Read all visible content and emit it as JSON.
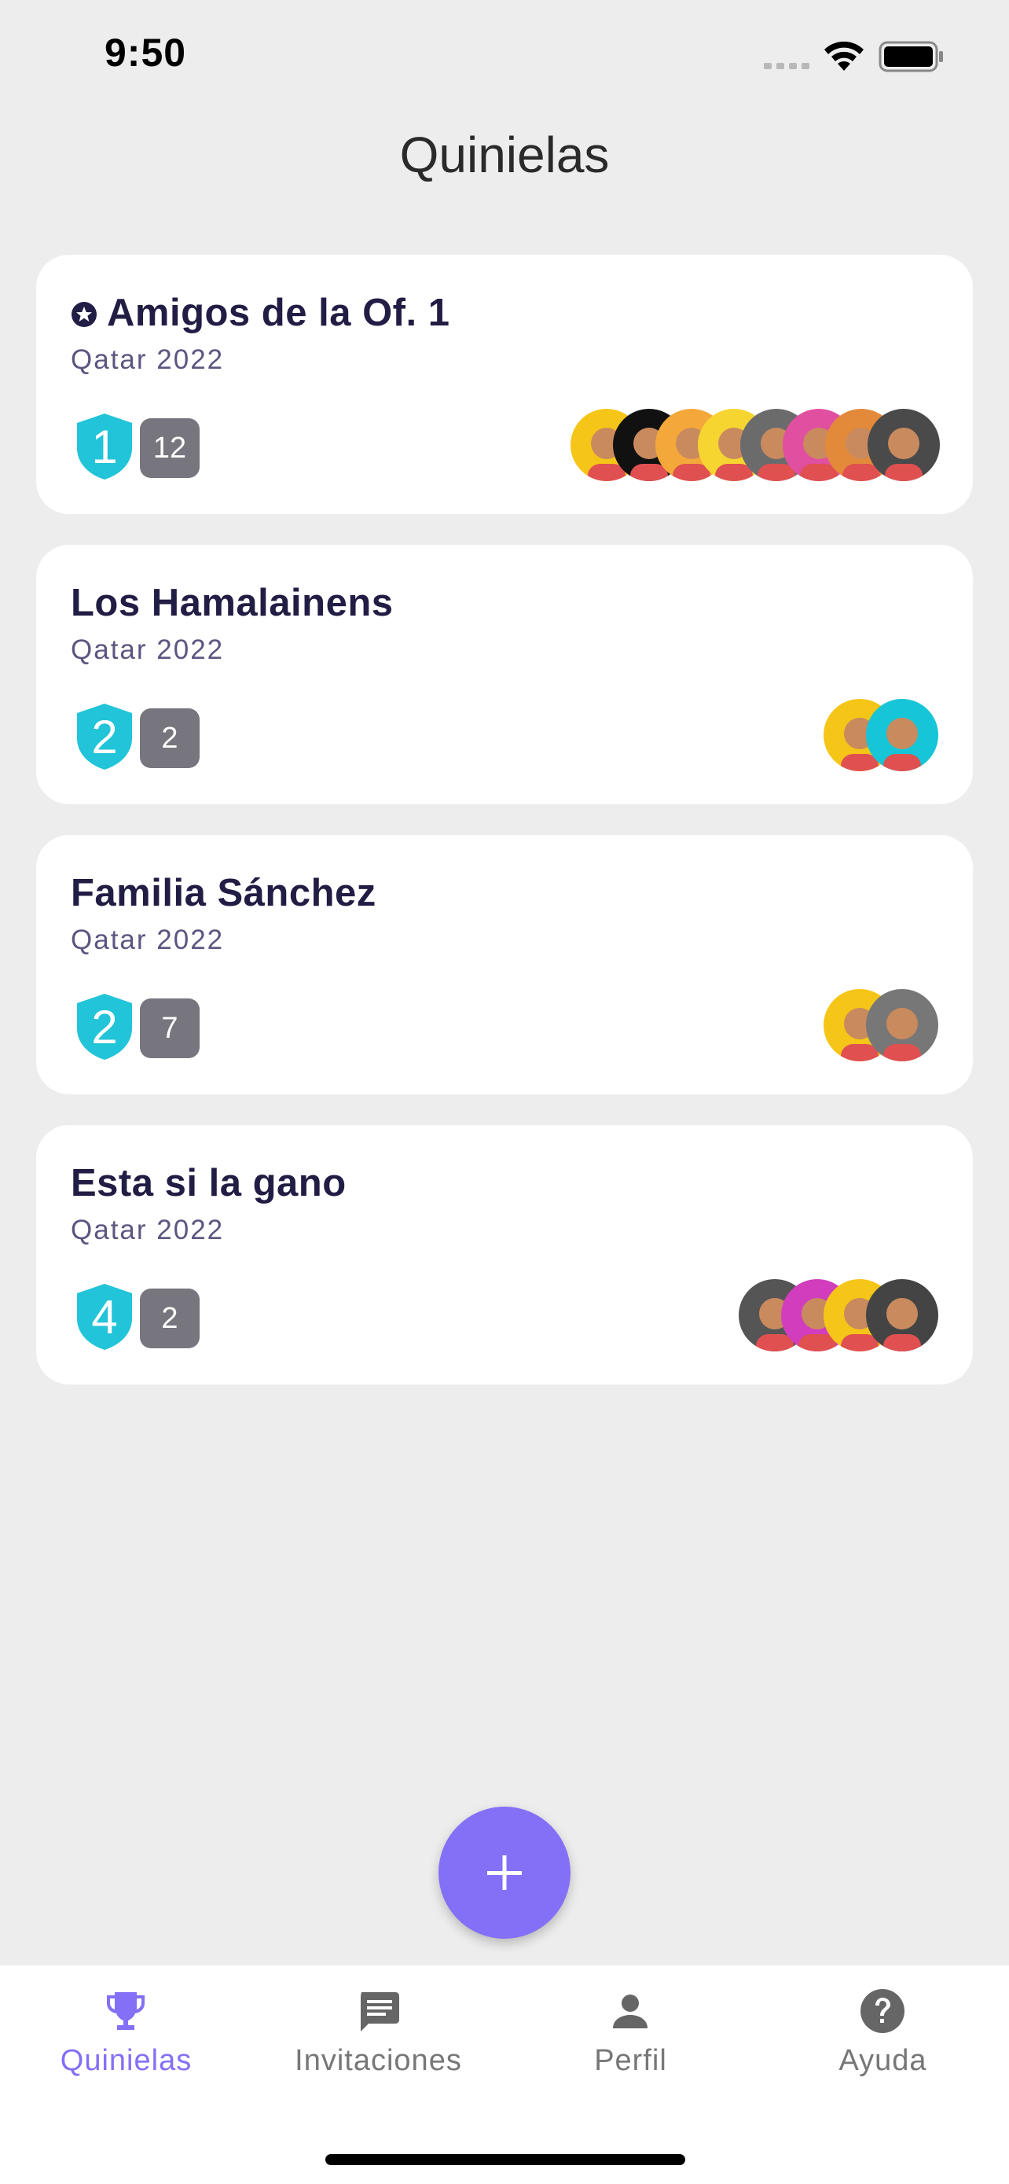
{
  "status": {
    "time": "9:50"
  },
  "header": {
    "title": "Quinielas"
  },
  "pools": [
    {
      "name": "Amigos de la Of. 1",
      "favorite": true,
      "subtitle": "Qatar 2022",
      "rank": "1",
      "members": "12",
      "avatars": [
        "#f5c518",
        "#111111",
        "#f4a83a",
        "#f7d531",
        "#6b6b6b",
        "#e14fa0",
        "#e38a3a",
        "#4a4a4a"
      ]
    },
    {
      "name": "Los Hamalainens",
      "favorite": false,
      "subtitle": "Qatar 2022",
      "rank": "2",
      "members": "2",
      "avatars": [
        "#f5c518",
        "#16c5d8"
      ]
    },
    {
      "name": "Familia Sánchez",
      "favorite": false,
      "subtitle": "Qatar 2022",
      "rank": "2",
      "members": "7",
      "avatars": [
        "#f5c518",
        "#777777"
      ]
    },
    {
      "name": "Esta si la gano",
      "favorite": false,
      "subtitle": "Qatar 2022",
      "rank": "4",
      "members": "2",
      "avatars": [
        "#555555",
        "#d23dbe",
        "#f5c518",
        "#444444"
      ]
    }
  ],
  "tabs": [
    {
      "label": "Quinielas",
      "icon": "trophy-icon",
      "active": true
    },
    {
      "label": "Invitaciones",
      "icon": "message-icon",
      "active": false
    },
    {
      "label": "Perfil",
      "icon": "person-icon",
      "active": false
    },
    {
      "label": "Ayuda",
      "icon": "help-icon",
      "active": false
    }
  ],
  "colors": {
    "accent": "#8370f7",
    "badge": "#21c4d8",
    "count": "#77757d",
    "title": "#221d44"
  }
}
